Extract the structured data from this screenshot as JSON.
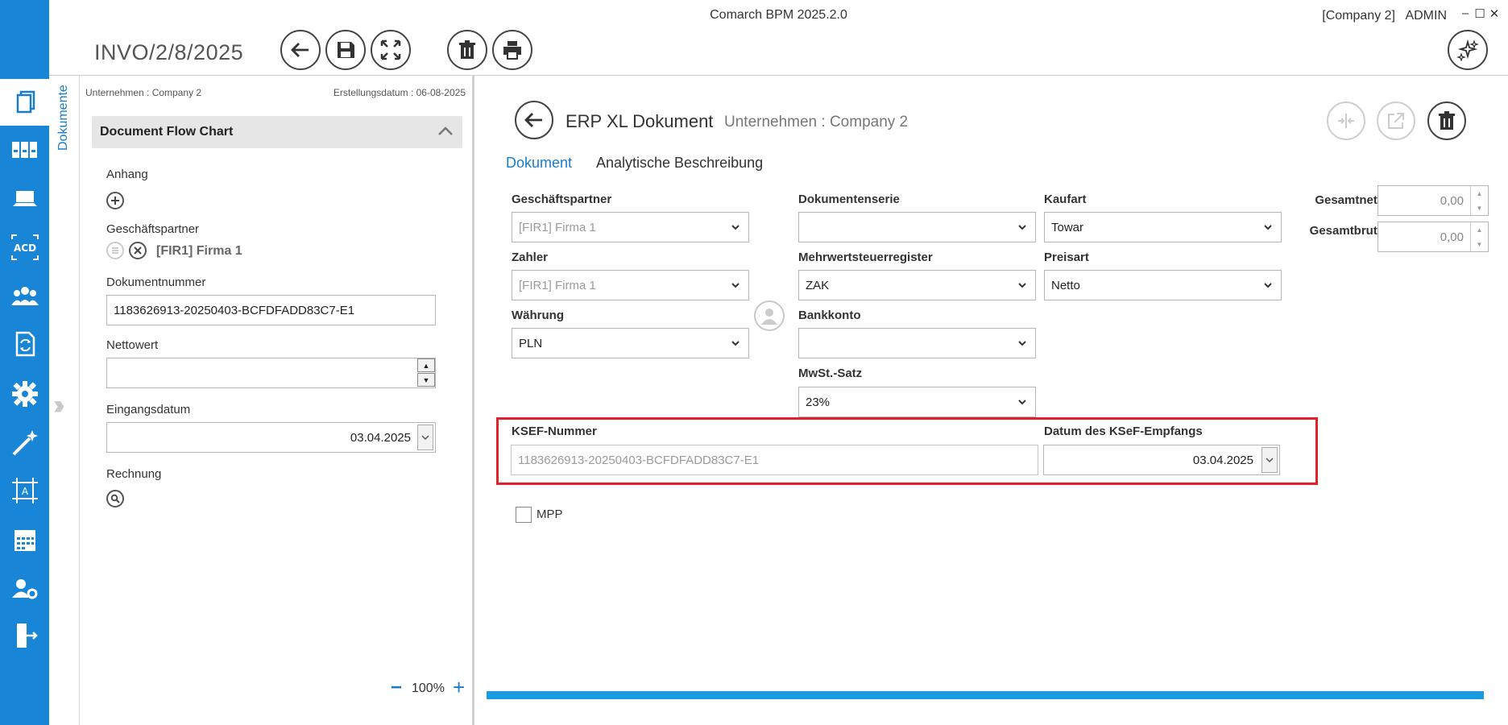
{
  "window": {
    "app_title": "Comarch BPM 2025.2.0",
    "company": "[Company 2]",
    "user": "ADMIN",
    "minimize": "–",
    "maximize": "☐",
    "close": "✕"
  },
  "header": {
    "document_number": "INVO/2/8/2025"
  },
  "vertical_tab": "Dokumente",
  "left_panel": {
    "company_label": "Unternehmen : Company 2",
    "created_label": "Erstellungsdatum : 06-08-2025",
    "flow_chart_title": "Document Flow Chart",
    "attachment_label": "Anhang",
    "partner_label": "Geschäftspartner",
    "partner_value": "[FIR1] Firma 1",
    "doc_number_label": "Dokumentnummer",
    "doc_number_value": "1183626913-20250403-BCFDFADD83C7-E1",
    "net_value_label": "Nettowert",
    "net_value": "",
    "receipt_date_label": "Eingangsdatum",
    "receipt_date_value": "03.04.2025",
    "invoice_label": "Rechnung",
    "zoom_minus": "−",
    "zoom": "100%",
    "zoom_plus": "+"
  },
  "form": {
    "title": "ERP XL Dokument",
    "company": "Unternehmen :  Company 2",
    "tabs": [
      "Dokument",
      "Analytische Beschreibung"
    ],
    "partner_label": "Geschäftspartner",
    "partner_value": "[FIR1] Firma 1",
    "payer_label": "Zahler",
    "payer_value": "[FIR1] Firma 1",
    "currency_label": "Währung",
    "currency_value": "PLN",
    "series_label": "Dokumentenserie",
    "series_value": "",
    "vat_register_label": "Mehrwertsteuerregister",
    "vat_register_value": "ZAK",
    "bank_label": "Bankkonto",
    "bank_value": "",
    "vat_rate_label": "MwSt.-Satz",
    "vat_rate_value": "23%",
    "purchase_type_label": "Kaufart",
    "purchase_type_value": "Towar",
    "price_type_label": "Preisart",
    "price_type_value": "Netto",
    "total_net_label": "Gesamtnetto:",
    "total_net_value": "0,00",
    "total_gross_label": "Gesamtbrutto:",
    "total_gross_value": "0,00",
    "ksef_label": "KSEF-Nummer",
    "ksef_value": "1183626913-20250403-BCFDFADD83C7-E1",
    "ksef_date_label": "Datum des KSeF-Empfangs",
    "ksef_date_value": "03.04.2025",
    "mpp_label": "MPP",
    "mpp_checked": false
  },
  "progress": {
    "value_percent": 100
  },
  "colors": {
    "rail": "#1985d6",
    "accent": "#1b7cc8",
    "highlight": "#e0202a",
    "progress": "#1a9be0"
  },
  "icons": [
    "documents-icon",
    "binders-icon",
    "laptop-icon",
    "ocr-icon",
    "users-icon",
    "workflow-doc-icon",
    "gear-icon",
    "magic-wand-icon",
    "form-designer-icon",
    "calendar-icon",
    "user-settings-icon",
    "logout-icon",
    "back-icon",
    "save-icon",
    "fullscreen-icon",
    "trash-icon",
    "print-icon",
    "ai-sparkle-icon",
    "merge-icon",
    "external-link-icon"
  ]
}
